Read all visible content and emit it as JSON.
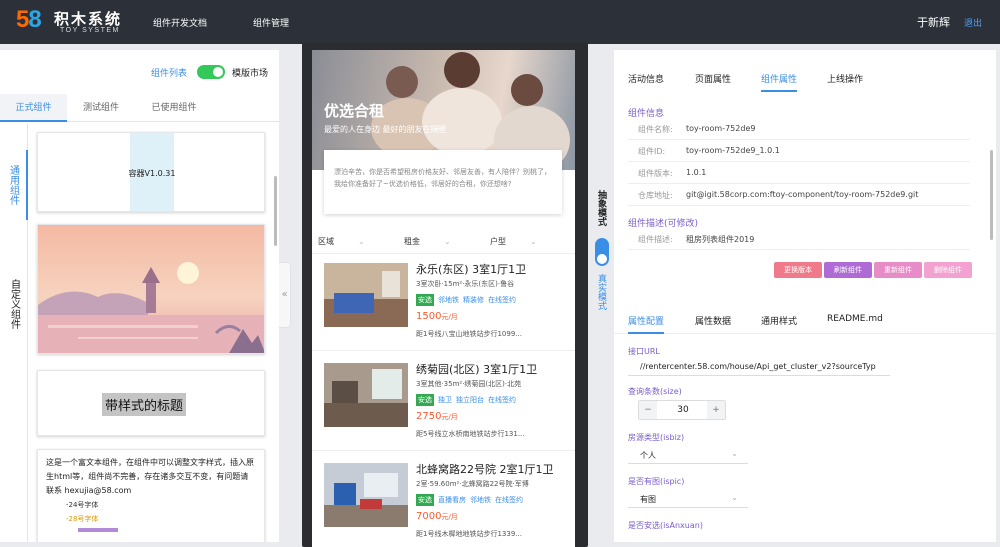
{
  "topbar": {
    "logo_digits_a": "5",
    "logo_digits_b": "8",
    "brand_cn": "积木系统",
    "brand_en": "TOY SYSTEM",
    "nav": [
      "组件开发文档",
      "组件管理"
    ],
    "user": "于新辉",
    "logout": "退出"
  },
  "left": {
    "toggle_label": "组件列表",
    "market_label": "模版市场",
    "tabs": [
      "正式组件",
      "测试组件",
      "已使用组件"
    ],
    "vtabs": [
      "通用组件",
      "自定义组件"
    ],
    "cards": {
      "container": "容器V1.0.31",
      "styled_title": "带样式的标题",
      "rich_text": "这是一个富文本组件，在组件中可以调整文字样式，插入原生html等，组件尚不完善，存在诸多交互不变，有问题请联系 hexujia@58.com",
      "size24": "-24号字体",
      "size28": "-28号字体"
    },
    "collapse": "«"
  },
  "phone": {
    "hero_title": "优选合租",
    "hero_sub": "最爱的人在身边  最好的朋友在隔壁",
    "quote_text": "漂泊辛苦，你是否希望租房价格友好、邻居友善，有人陪伴？别桃了，我给你准备好了~优选价格低，邻居好的合租，你还想啥?",
    "filters": [
      "区域",
      "租金",
      "户型"
    ],
    "listings": [
      {
        "title": "永乐(东区) 3室1厅1卫",
        "info": "3室次卧·15m²·永乐(东区)·鲁谷",
        "tags": [
          "安选",
          "邻地铁",
          "精装修",
          "在线签约"
        ],
        "price": "1500",
        "unit": "元/月",
        "transit": "距1号线八宝山地铁站步行1099..."
      },
      {
        "title": "绣菊园(北区) 3室1厅1卫",
        "info": "3室其他·35m²·绣菊园(北区)·北苑",
        "tags": [
          "安选",
          "独卫",
          "独立阳台",
          "在线签约"
        ],
        "price": "2750",
        "unit": "元/月",
        "transit": "距5号线立水桥南地铁站步行131..."
      },
      {
        "title": "北蜂窝路22号院 2室1厅1卫",
        "info": "2室·59.60m²·北蜂窝路22号院·军博",
        "tags": [
          "安选",
          "直播看房",
          "邻地铁",
          "在线签约"
        ],
        "price": "7000",
        "unit": "元/月",
        "transit": "距1号线木樨地地铁站步行1339..."
      }
    ]
  },
  "mode": {
    "draw": "抽象模式",
    "real": "真实模式"
  },
  "right": {
    "tabs": [
      "活动信息",
      "页面属性",
      "组件属性",
      "上线操作"
    ],
    "info_header": "组件信息",
    "info": [
      {
        "k": "组件名称:",
        "v": "toy-room-752de9"
      },
      {
        "k": "组件ID:",
        "v": "toy-room-752de9_1.0.1"
      },
      {
        "k": "组件版本:",
        "v": "1.0.1"
      },
      {
        "k": "仓库地址:",
        "v": "git@igit.58corp.com:ftoy-component/toy-room-752de9.git"
      }
    ],
    "desc_header": "组件描述(可修改)",
    "desc": {
      "k": "组件描述:",
      "v": "租房列表组件2019"
    },
    "buttons": [
      {
        "label": "更换版本",
        "color": "#f07a8a"
      },
      {
        "label": "刷新组件",
        "color": "#b06ad6"
      },
      {
        "label": "重新组件",
        "color": "#e88cc8"
      },
      {
        "label": "删除组件",
        "color": "#f2a1d0"
      }
    ],
    "tabs2": [
      "属性配置",
      "属性数据",
      "通用样式",
      "README.md"
    ],
    "fields": {
      "api_label": "接口URL",
      "api_value": "//rentercenter.58.com/house/Api_get_cluster_v2?sourceTyp",
      "size_label": "查询条数(size)",
      "size_value": "30",
      "isbiz_label": "房源类型(isbiz)",
      "isbiz_value": "个人",
      "ispic_label": "是否有图(ispic)",
      "ispic_value": "有图",
      "anxuan_label": "是否安选(isAnxuan)"
    }
  }
}
